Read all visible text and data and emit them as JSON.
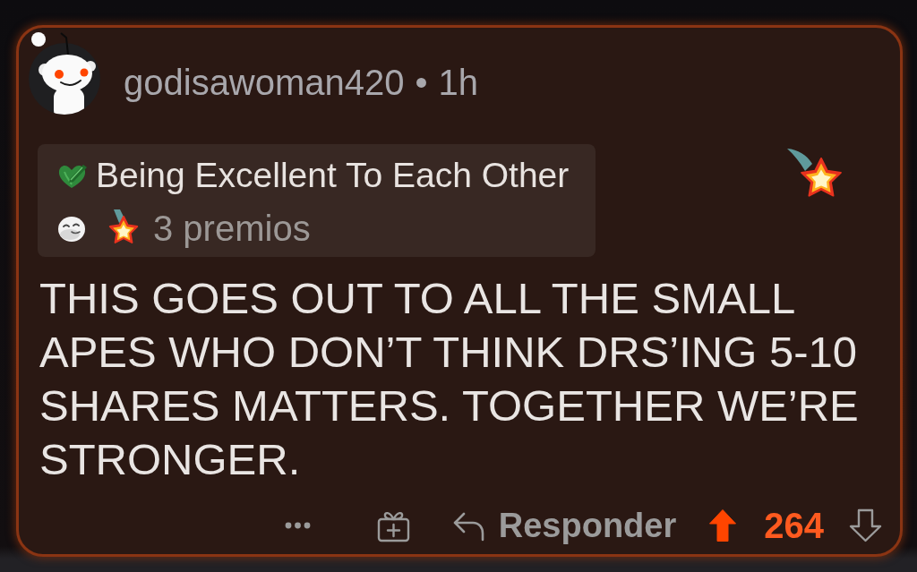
{
  "comment": {
    "author": "godisawoman420",
    "separator": "•",
    "age": "1h"
  },
  "awards": {
    "featured_award": "Being Excellent To Each Other",
    "count": "3 premios"
  },
  "body": "THIS GOES OUT TO ALL THE SMALL APES WHO DON’T THINK DRS’ING 5-10 SHARES MATTERS. TOGETHER WE’RE STRONGER.",
  "actions": {
    "reply": "Responder",
    "score": "264",
    "upvoted": true
  }
}
